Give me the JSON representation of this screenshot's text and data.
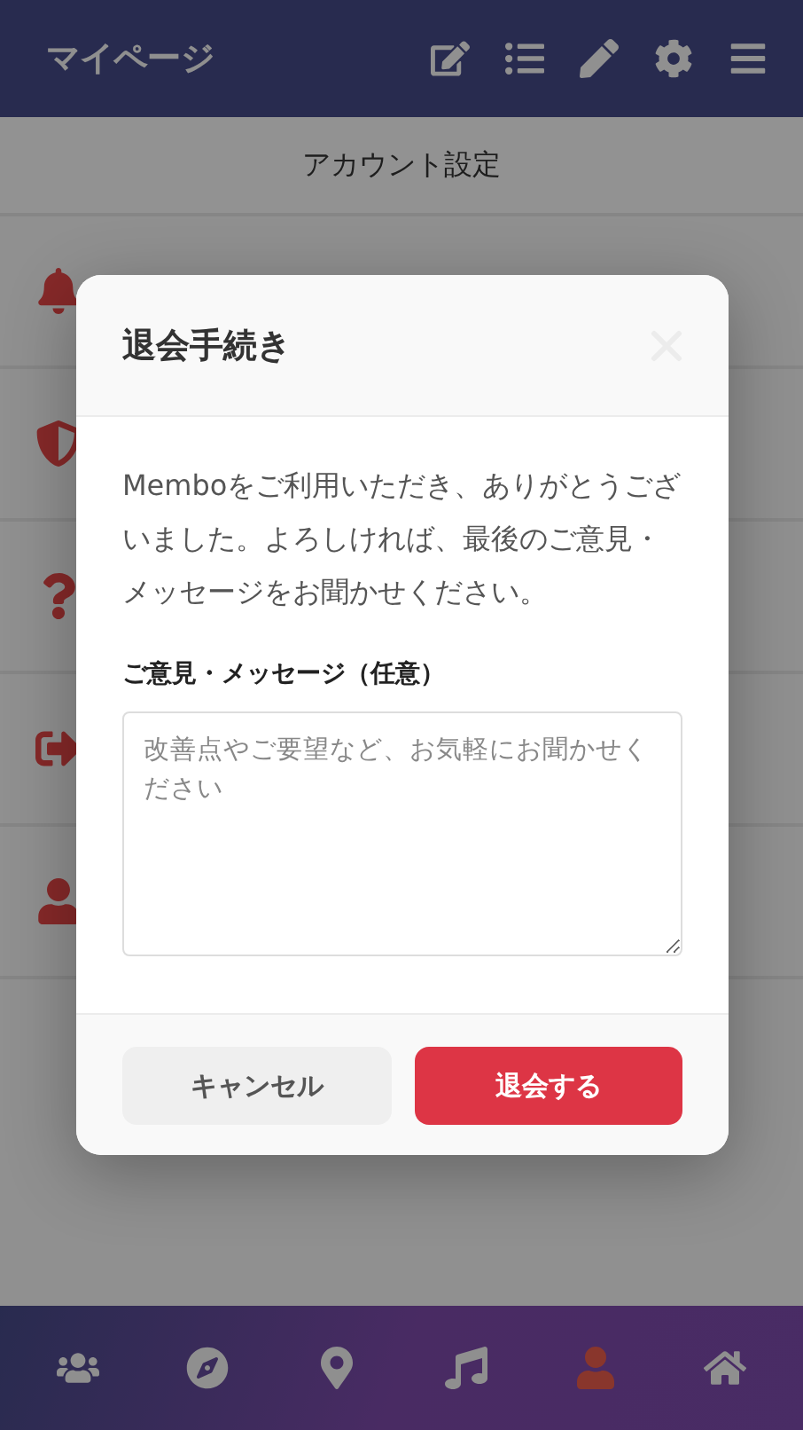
{
  "header": {
    "title": "マイページ"
  },
  "section_title": "アカウント設定",
  "bottom_nav": [
    {
      "selected": false
    },
    {
      "selected": false
    },
    {
      "selected": false
    },
    {
      "selected": false
    },
    {
      "selected": true
    },
    {
      "selected": false
    }
  ],
  "dialog": {
    "title": "退会手続き",
    "message": "Memboをご利用いただき、ありがとうございました。よろしければ、最後のご意見・メッセージをお聞かせください。",
    "field_label": "ご意見・メッセージ（任意）",
    "placeholder": "改善点やご要望など、お気軽にお聞かせください",
    "buttons": [
      {
        "label": "キャンセル",
        "kind": "secondary"
      },
      {
        "label": "退会する",
        "kind": "danger"
      }
    ]
  }
}
